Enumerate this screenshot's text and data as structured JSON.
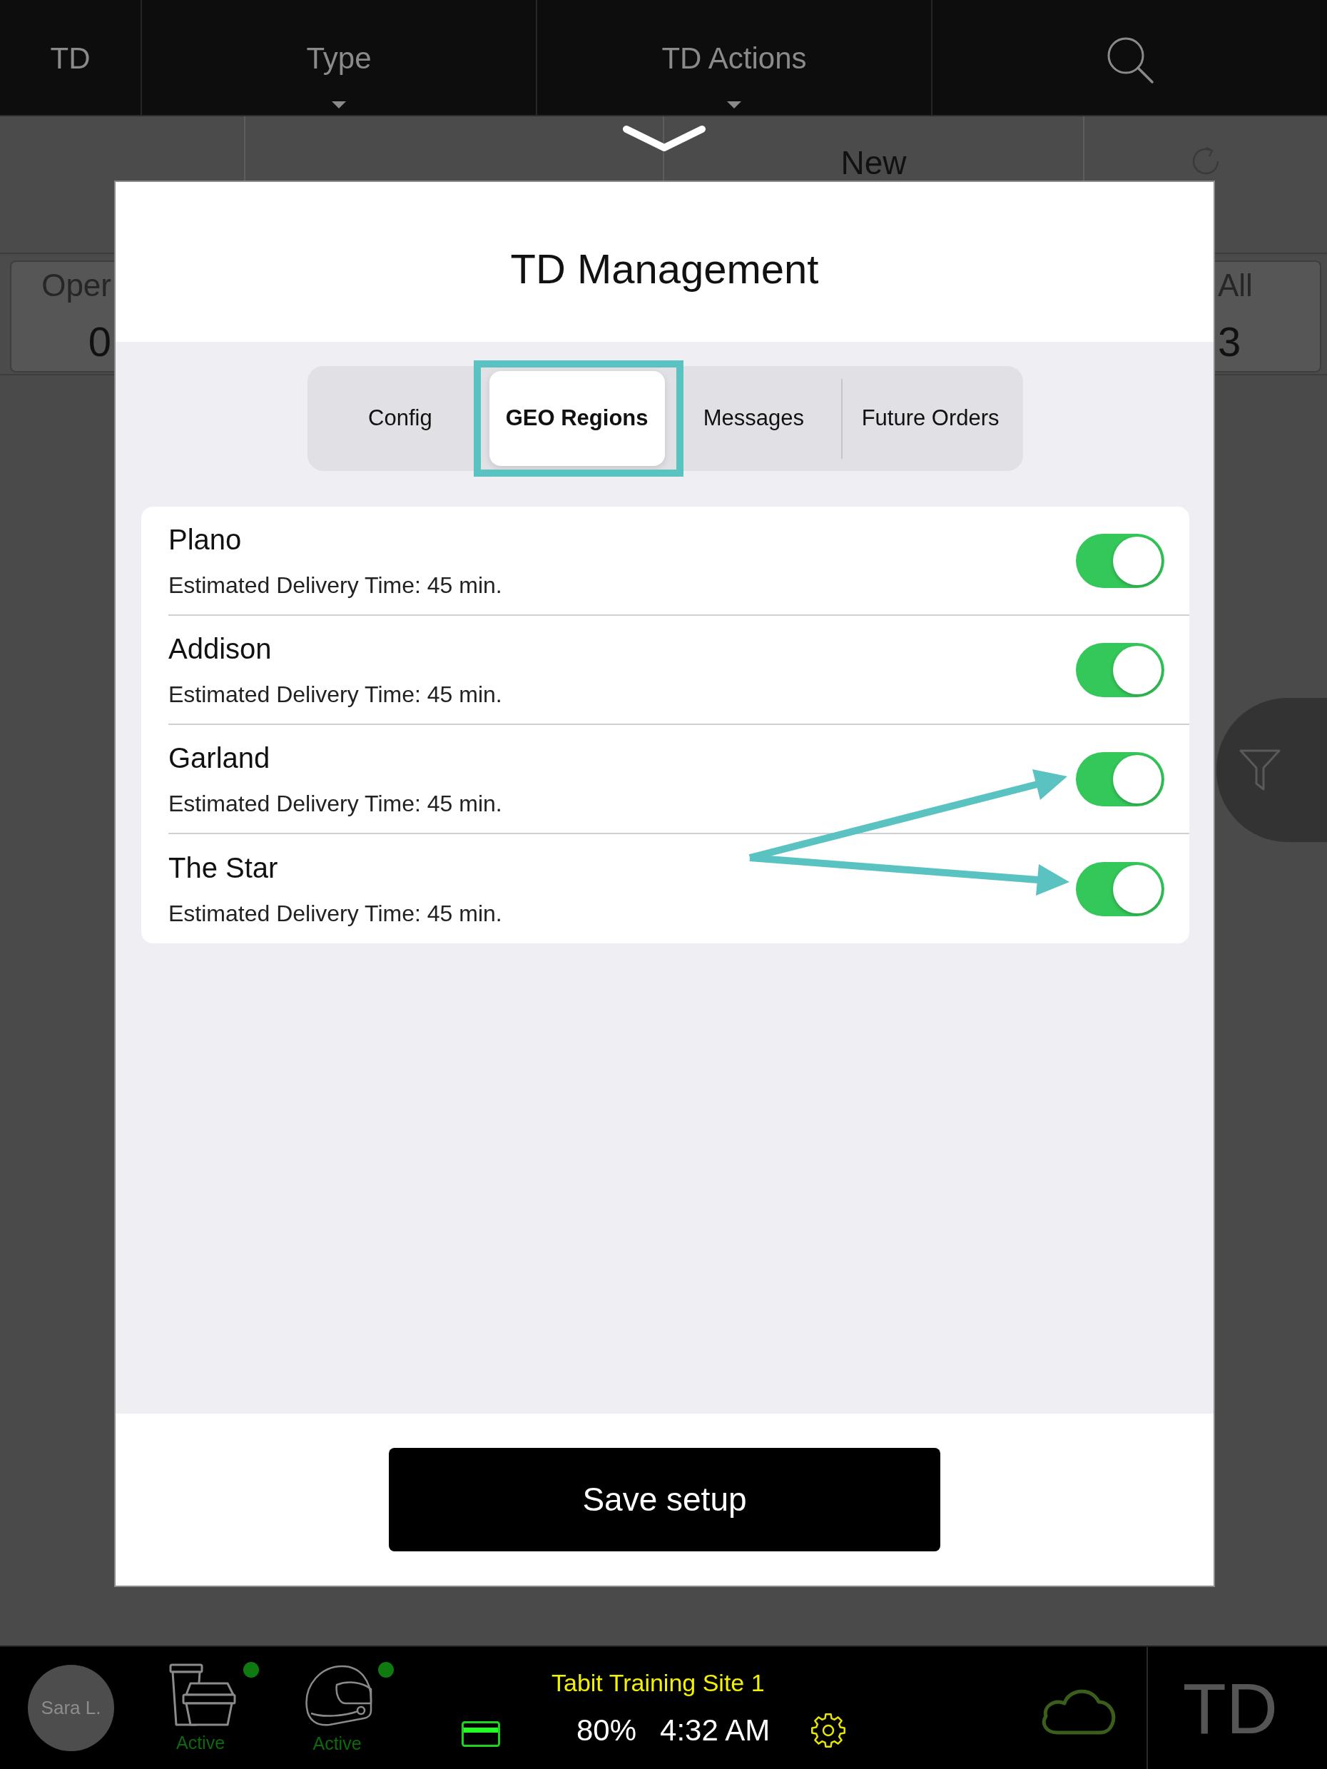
{
  "top_bar": {
    "items": [
      {
        "kind": "title",
        "label": "TD"
      },
      {
        "kind": "dropdown",
        "label": "Type"
      },
      {
        "kind": "dropdown",
        "label": "TD Actions"
      },
      {
        "kind": "search"
      }
    ]
  },
  "action_row": {
    "items": [
      {
        "kind": "text",
        "label": "New"
      },
      {
        "kind": "refresh"
      }
    ]
  },
  "counters": [
    {
      "label": "Oper",
      "value": "0"
    },
    {
      "label": "All",
      "value": "3"
    }
  ],
  "modal": {
    "title": "TD Management",
    "tabs": [
      {
        "label": "Config",
        "selected": false
      },
      {
        "label": "GEO Regions",
        "selected": true
      },
      {
        "label": "Messages",
        "selected": false
      },
      {
        "label": "Future Orders",
        "selected": false
      }
    ],
    "regions": [
      {
        "name": "Plano",
        "detail": "Estimated Delivery Time: 45 min.",
        "on": true
      },
      {
        "name": "Addison",
        "detail": "Estimated Delivery Time: 45 min.",
        "on": true
      },
      {
        "name": "Garland",
        "detail": "Estimated Delivery Time: 45 min.",
        "on": true
      },
      {
        "name": "The Star",
        "detail": "Estimated Delivery Time: 45 min.",
        "on": true
      }
    ],
    "save_button": "Save setup"
  },
  "bottom_bar": {
    "user": "Sara L.",
    "services": [
      {
        "kind": "takeaway",
        "status": "Active",
        "online": true
      },
      {
        "kind": "delivery",
        "status": "Active",
        "online": true
      }
    ],
    "site": "Tabit Training Site 1",
    "battery": "80%",
    "time": "4:32 AM",
    "app_label": "TD"
  }
}
